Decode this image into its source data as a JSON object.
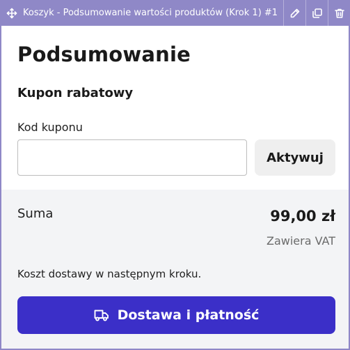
{
  "toolbar": {
    "title": "Koszyk - Podsumowanie wartości produktów (Krok 1) #1",
    "icons": [
      "move-icon",
      "edit-icon",
      "duplicate-icon",
      "delete-icon"
    ],
    "background": "#8f88c7"
  },
  "summary": {
    "heading": "Podsumowanie",
    "coupon_section_title": "Kupon rabatowy",
    "coupon_label": "Kod kuponu",
    "coupon_value": "",
    "coupon_placeholder": "",
    "activate_label": "Aktywuj",
    "sum_label": "Suma",
    "sum_value": "99,00 zł",
    "vat_note": "Zawiera VAT",
    "shipping_note": "Koszt dostawy w następnym kroku.",
    "checkout_label": "Dostawa i płatność",
    "checkout_icon": "truck-icon",
    "accent_color": "#3b2fc8"
  }
}
